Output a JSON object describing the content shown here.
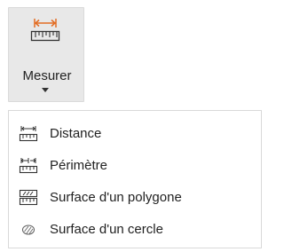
{
  "ribbon": {
    "label": "Mesurer",
    "icon": "ruler-distance-icon",
    "accent_color": "#e36c22"
  },
  "menu": {
    "items": [
      {
        "label": "Distance",
        "icon": "distance-ruler-icon"
      },
      {
        "label": "Périmètre",
        "icon": "perimeter-ruler-icon"
      },
      {
        "label": "Surface d'un polygone",
        "icon": "polygon-area-icon"
      },
      {
        "label": "Surface d'un cercle",
        "icon": "circle-area-icon"
      }
    ]
  }
}
